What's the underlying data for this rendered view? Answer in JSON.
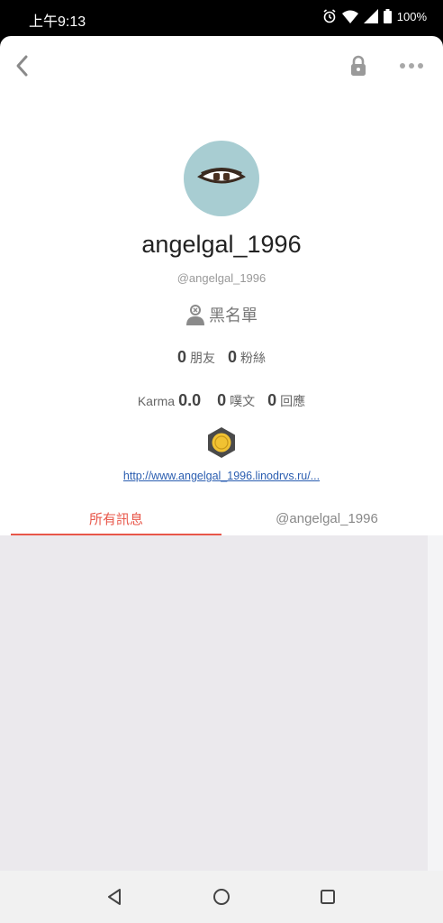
{
  "status_bar": {
    "time": "上午9:13",
    "battery": "100%",
    "icons": [
      "alarm-icon",
      "wifi-icon",
      "signal-icon",
      "battery-icon"
    ]
  },
  "top_bar": {
    "icons": [
      "back-icon",
      "lock-icon",
      "more-icon"
    ]
  },
  "profile": {
    "display_name": "angelgal_1996",
    "handle": "@angelgal_1996",
    "blacklist_label": "黑名單",
    "friends_count": "0",
    "friends_label": "朋友",
    "fans_count": "0",
    "fans_label": "粉絲",
    "karma_label": "Karma",
    "karma_value": "0.0",
    "plurks_count": "0",
    "plurks_label": "噗文",
    "responses_count": "0",
    "responses_label": "回應",
    "link": "http://www.angelgal_1996.linodrvs.ru/..."
  },
  "tabs": [
    {
      "label": "所有訊息",
      "active": true
    },
    {
      "label": "@angelgal_1996",
      "active": false
    }
  ],
  "colors": {
    "accent": "#e8574a",
    "link": "#2a5db0",
    "avatar_bg": "#a8cdd2",
    "content_bg": "#ebe9ed"
  },
  "nav_bar": {
    "icons": [
      "nav-back-icon",
      "nav-home-icon",
      "nav-recent-icon"
    ]
  }
}
